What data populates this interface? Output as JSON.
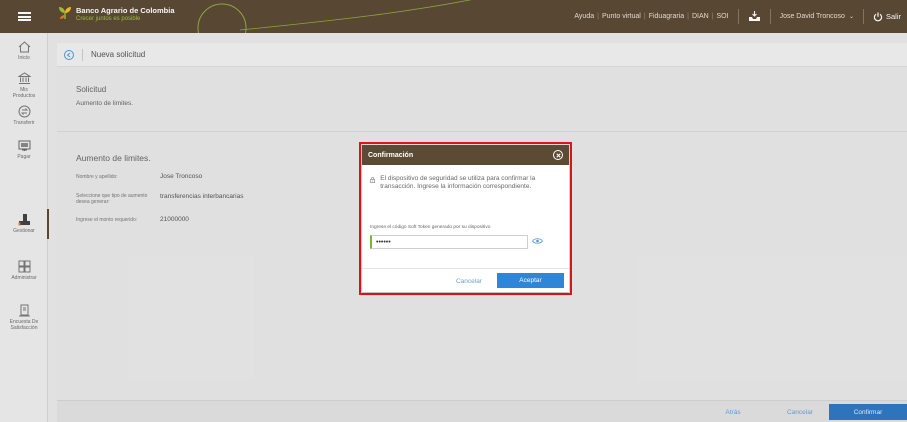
{
  "brand": {
    "name": "Banco Agrario de Colombia",
    "slogan": "Crecer juntos es posible"
  },
  "toplinks": [
    "Ayuda",
    "Punto virtual",
    "Fiduagraria",
    "DIAN",
    "SOI"
  ],
  "user": {
    "name": "Jose David Troncoso",
    "logout": "Salir"
  },
  "sidebar": {
    "items": [
      {
        "label": "Inicio",
        "icon": "home-icon"
      },
      {
        "label": "Mis Productos",
        "icon": "bank-icon"
      },
      {
        "label": "Transferir",
        "icon": "transfer-icon"
      },
      {
        "label": "Pagar",
        "icon": "pay-icon"
      },
      {
        "label": "Gestionar",
        "icon": "manage-icon"
      },
      {
        "label": "Administrar",
        "icon": "grid-icon"
      },
      {
        "label": "Encuesta De Satisfacción",
        "icon": "survey-icon"
      }
    ]
  },
  "page": {
    "title": "Nueva solicitud",
    "solicitud_title": "Solicitud",
    "solicitud_text": "Aumento de limites.",
    "section_title": "Aumento de limites.",
    "fields": [
      {
        "label": "Nombre y apellido:",
        "value": "Jose Troncoso"
      },
      {
        "label": "Seleccione que tipo de aumento desea generar:",
        "value": "transferencias interbancarias"
      },
      {
        "label": "Ingrese el monto requerido:",
        "value": "21000000"
      }
    ]
  },
  "footer": {
    "back": "Atrás",
    "cancel": "Cancelar",
    "confirm": "Confirmar"
  },
  "modal": {
    "title": "Confirmación",
    "message": "El dispositivo de seguridad se utiliza para confirmar la transacción. Ingrese la información correspondiente.",
    "token_label": "Ingrese el código Soft Token generado por su dispositivo",
    "token_value": "••••••",
    "cancel": "Cancelar",
    "accept": "Aceptar"
  },
  "colors": {
    "topbar": "#5b4a34",
    "accent_blue": "#2f86d6",
    "highlight_red": "#e0141b",
    "brand_green": "#9ec43a"
  }
}
